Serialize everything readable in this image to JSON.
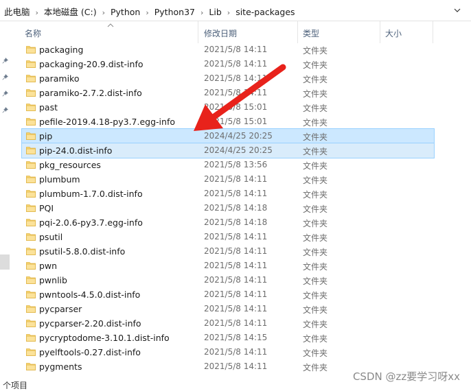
{
  "breadcrumb": {
    "items": [
      "此电脑",
      "本地磁盘 (C:)",
      "Python",
      "Python37",
      "Lib",
      "site-packages"
    ]
  },
  "columns": {
    "name": "名称",
    "date": "修改日期",
    "type": "类型",
    "size": "大小"
  },
  "files": [
    {
      "name": "packaging",
      "date": "2021/5/8 14:11",
      "type": "文件夹"
    },
    {
      "name": "packaging-20.9.dist-info",
      "date": "2021/5/8 14:11",
      "type": "文件夹"
    },
    {
      "name": "paramiko",
      "date": "2021/5/8 14:11",
      "type": "文件夹"
    },
    {
      "name": "paramiko-2.7.2.dist-info",
      "date": "2021/5/8 14:11",
      "type": "文件夹"
    },
    {
      "name": "past",
      "date": "2021/5/8 15:01",
      "type": "文件夹"
    },
    {
      "name": "pefile-2019.4.18-py3.7.egg-info",
      "date": "2021/5/8 15:01",
      "type": "文件夹"
    },
    {
      "name": "pip",
      "date": "2024/4/25 20:25",
      "type": "文件夹",
      "selected": true
    },
    {
      "name": "pip-24.0.dist-info",
      "date": "2024/4/25 20:25",
      "type": "文件夹",
      "selected": true
    },
    {
      "name": "pkg_resources",
      "date": "2021/5/8 13:56",
      "type": "文件夹"
    },
    {
      "name": "plumbum",
      "date": "2021/5/8 14:11",
      "type": "文件夹"
    },
    {
      "name": "plumbum-1.7.0.dist-info",
      "date": "2021/5/8 14:11",
      "type": "文件夹"
    },
    {
      "name": "PQI",
      "date": "2021/5/8 14:18",
      "type": "文件夹"
    },
    {
      "name": "pqi-2.0.6-py3.7.egg-info",
      "date": "2021/5/8 14:18",
      "type": "文件夹"
    },
    {
      "name": "psutil",
      "date": "2021/5/8 14:11",
      "type": "文件夹"
    },
    {
      "name": "psutil-5.8.0.dist-info",
      "date": "2021/5/8 14:11",
      "type": "文件夹"
    },
    {
      "name": "pwn",
      "date": "2021/5/8 14:11",
      "type": "文件夹"
    },
    {
      "name": "pwnlib",
      "date": "2021/5/8 14:11",
      "type": "文件夹"
    },
    {
      "name": "pwntools-4.5.0.dist-info",
      "date": "2021/5/8 14:11",
      "type": "文件夹"
    },
    {
      "name": "pycparser",
      "date": "2021/5/8 14:11",
      "type": "文件夹"
    },
    {
      "name": "pycparser-2.20.dist-info",
      "date": "2021/5/8 14:11",
      "type": "文件夹"
    },
    {
      "name": "pycryptodome-3.10.1.dist-info",
      "date": "2021/5/8 14:15",
      "type": "文件夹"
    },
    {
      "name": "pyelftools-0.27.dist-info",
      "date": "2021/5/8 14:11",
      "type": "文件夹"
    },
    {
      "name": "pygments",
      "date": "2021/5/8 14:11",
      "type": "文件夹"
    }
  ],
  "status": {
    "text": "个项目"
  },
  "watermark": "CSDN @zz要学习呀xx",
  "colors": {
    "selection": "#cce8ff",
    "selection_border": "#99d1ff",
    "folder": "#f8d775",
    "arrow": "#e8221b"
  },
  "icons": {
    "folder": "folder-icon",
    "pin": "pin-icon",
    "sort": "sort-up-icon",
    "dropdown": "chevron-down-icon"
  }
}
